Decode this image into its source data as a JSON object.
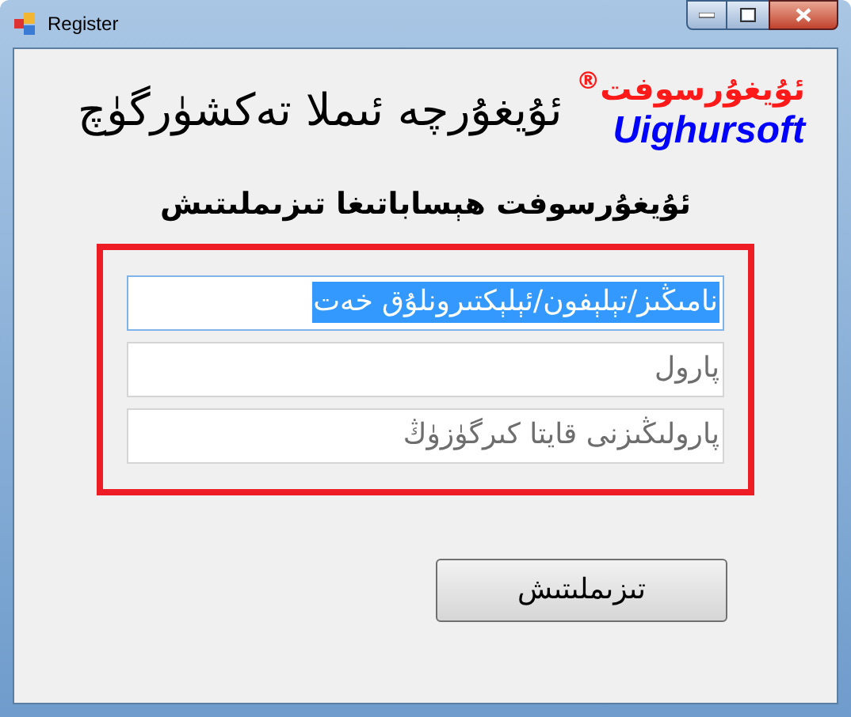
{
  "window": {
    "title": "Register"
  },
  "app_title": "ئۇيغۇرچە ئىملا تەكشۈرگۈچ",
  "logo": {
    "name": "ئۇيغۇرسوفت",
    "mark": "®",
    "latin": "Uighursoft"
  },
  "heading": "ئۇيغۇرسوفت ھېساباتىغا تىزىملىتىش",
  "fields": [
    {
      "value": "نامىڭىز/تېلېفون/ئېلېكتىرونلۇق خەت",
      "selected": true
    },
    {
      "placeholder": "پارول",
      "selected": false
    },
    {
      "placeholder": "پارولىڭىزنى قايتا كىرگۈزۈڭ",
      "selected": false
    }
  ],
  "button": "تىزىملىتىش"
}
